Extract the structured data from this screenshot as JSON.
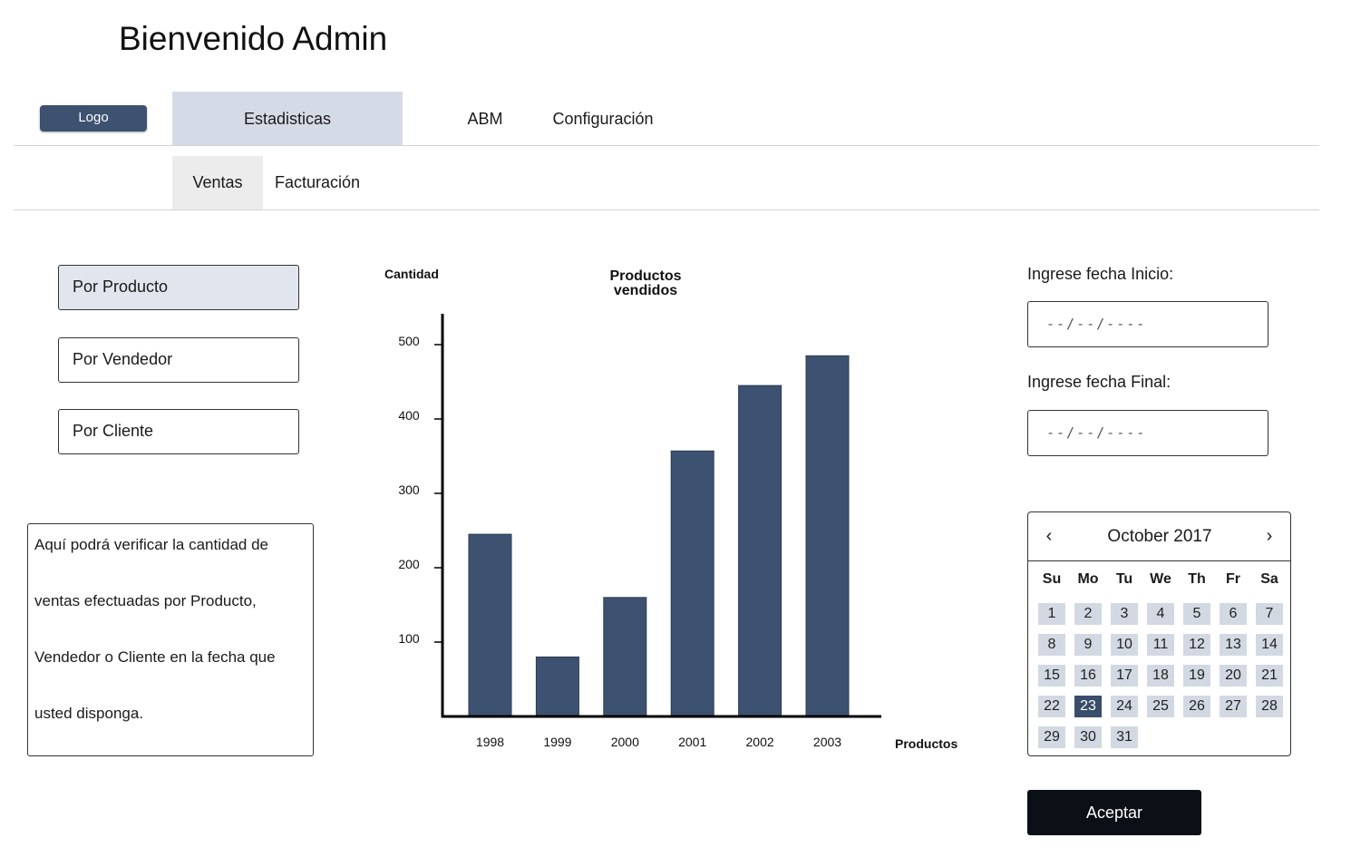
{
  "header": {
    "title": "Bienvenido Admin",
    "logo_label": "Logo"
  },
  "nav": {
    "tabs": [
      "Estadisticas",
      "ABM",
      "Configuración"
    ],
    "active": "Estadisticas"
  },
  "subnav": {
    "tabs": [
      "Ventas",
      "Facturación"
    ],
    "active": "Ventas"
  },
  "sidebar": {
    "buttons": [
      "Por Producto",
      "Por Vendedor",
      "Por Cliente"
    ],
    "active": "Por Producto"
  },
  "info": {
    "lines": [
      "Aquí podrá verificar la cantidad de",
      "ventas efectuadas por Producto,",
      "Vendedor o Cliente en la fecha que",
      "usted disponga."
    ]
  },
  "chart_data": {
    "type": "bar",
    "title": [
      "Productos",
      "vendidos"
    ],
    "ylabel": "Cantidad",
    "xlabel": "Productos",
    "categories": [
      "1998",
      "1999",
      "2000",
      "2001",
      "2002",
      "2003"
    ],
    "values": [
      245,
      80,
      160,
      357,
      445,
      485
    ],
    "yticks": [
      100,
      200,
      300,
      400,
      500
    ],
    "ylim": [
      0,
      525
    ],
    "bar_color": "#3d5170",
    "grid": false
  },
  "date_form": {
    "start_label": "Ingrese fecha Inicio:",
    "start_placeholder": "--/--/----",
    "end_label": "Ingrese fecha Final:",
    "end_placeholder": "--/--/----"
  },
  "calendar": {
    "month_label": "October 2017",
    "prev_glyph": "‹",
    "next_glyph": "›",
    "weekdays": [
      "Su",
      "Mo",
      "Tu",
      "We",
      "Th",
      "Fr",
      "Sa"
    ],
    "days_in_month": 31,
    "first_weekday_index": 0,
    "selected_day": 23
  },
  "accept_label": "Aceptar",
  "colors": {
    "accent": "#3d5170",
    "tab_active": "#d5dbe6",
    "day_bg": "#d2d9e3",
    "button_dark": "#0b0f16"
  }
}
